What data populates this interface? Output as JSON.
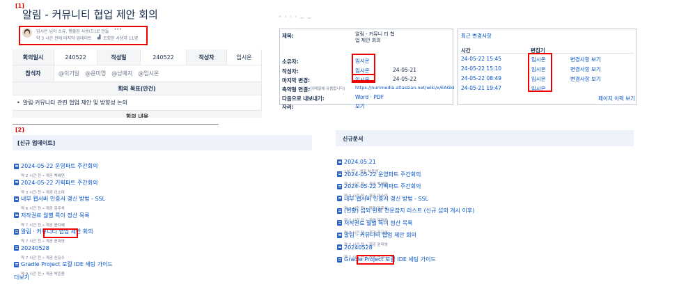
{
  "section1": {
    "tag": "[1]",
    "title": "알림 - 커뮤니티 협업 제안 회의",
    "byline": {
      "line1": "임시온 님이 소유, 행출된 사용(드)로 만듦",
      "line1_more": "•••",
      "line2": "약 3 시간 전에 마지막 업데이트",
      "views": "조회한 사용자 11명"
    },
    "meeting_table": {
      "date_label": "회의일시",
      "date_value": "240522",
      "written_label": "작성일",
      "written_value": "240522",
      "author_label": "작성자",
      "author_value": "임시온",
      "attendees_label": "참석자",
      "attendees": [
        "@이기일",
        "@윤미영",
        "@남예지",
        "@임시온"
      ],
      "goal_header": "회의 목표(안건)",
      "goal_item": "알림·커뮤니티 관련 협업 제안 및 방향성 논의",
      "cut_text": "회의 내용"
    },
    "page_info": {
      "rows": [
        {
          "label": "제목:",
          "value": "알림 - 커뮤니 티 협업 제안 회의",
          "date": ""
        },
        {
          "label": "소유자:",
          "value": "임시온",
          "date": ""
        },
        {
          "label": "작성자:",
          "value": "임시온",
          "date": "24-05-21"
        },
        {
          "label": "마지막 변경:",
          "value": "임시온",
          "date": "24-05-22"
        },
        {
          "label": "축약형 연결:",
          "value": "(이메일에 유용합니다)",
          "date": "",
          "link": "https://nurimedia.atlassian.net/wiki/x/EAGkI"
        },
        {
          "label": "다음으로 내보내기:",
          "value": "Word · PDF",
          "date": ""
        },
        {
          "label": "자러:",
          "value": "보기",
          "date": ""
        }
      ]
    },
    "recent_changes": {
      "title": "최근 변경사항",
      "col_time": "시간",
      "col_editor": "편집기",
      "rows": [
        {
          "time": "24-05-22 15:45",
          "editor": "임시온",
          "action": "변경사항 보기"
        },
        {
          "time": "24-05-22 15:10",
          "editor": "임시온",
          "action": "변경사항 보기"
        },
        {
          "time": "24-05-22 08:49",
          "editor": "임시온",
          "action": "변경사항 보기"
        },
        {
          "time": "24-05-21 19:47",
          "editor": "임시온",
          "action": ""
        }
      ],
      "history_link": "페이지 이력 보기"
    }
  },
  "section2": {
    "tag": "[2]",
    "left_panel": {
      "title": "[신규 업데이트]",
      "items": [
        {
          "name": "2024-05-22 운영파트 주간회의",
          "meta": "약 2 시간 전 • 게공 백혜연"
        },
        {
          "name": "2024-05-22 기획파트 주간회의",
          "meta": "약 3 시간 전 • 게공 이소미"
        },
        {
          "name": "내부 웹서버 인증서 갱신 방법 - SSL",
          "meta": "약 6 시간 전 • 게공 김주석"
        },
        {
          "name": "저작권료 월별 특이 정산 목록",
          "meta": "약 7 시간 전 • 게공 윤지혜"
        },
        {
          "name": "알림 · 커뮤니티 협업 제안 회의",
          "meta": "약 7 시간 전 • 게공 윤미영"
        },
        {
          "name": "20240528",
          "meta": "약 7 시간 전 • 게공 신유수"
        },
        {
          "name": "Gradle Project 로컬 IDE 세팅 가이드",
          "meta": "약 9 시간 전 • 게공 박준용"
        }
      ],
      "more": "더보기"
    },
    "right_panel": {
      "title": "신규문서",
      "items": [
        {
          "name": "2024.05.21",
          "meta": "1분 전 • 게공 차종영"
        },
        {
          "name": "2024-05-22 운영파트 주간회의",
          "meta": "약 2 시간 전 • 게공 백혜연"
        },
        {
          "name": "2024-05-22 기획파트 주간회의",
          "meta": "약 3 시간 전 • 게공 이소미"
        },
        {
          "name": "내부 웹서버 인증서 갱신 방법 - SSL",
          "meta": "약 7 시간 전 • 게공 김주석"
        },
        {
          "name": "(현황) 섭외 완료 전문잡지 리스트 (신규 섭외 개시 이후)",
          "meta": "약 7 시간 전 • 게공 뮤미라"
        },
        {
          "name": "저작권료 월별 특이 정산 목록",
          "meta": "약 7 시간 전 • 게공 윤지혜"
        },
        {
          "name": "알림 - 커뮤니티 협업 제안 회의",
          "meta": "약 7 시간 전 • 게공 윤미영"
        },
        {
          "name": "20240528",
          "meta": "약 7 시간 전 • 게공 신유수"
        },
        {
          "name": "Gradle Project 로컬 IDE 세팅 가이드",
          "meta": ""
        }
      ]
    }
  }
}
